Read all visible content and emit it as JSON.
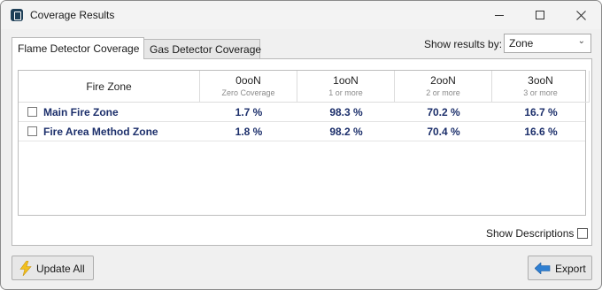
{
  "window": {
    "title": "Coverage Results"
  },
  "tabs": [
    {
      "label": "Flame Detector Coverage",
      "active": true
    },
    {
      "label": "Gas Detector Coverage",
      "active": false
    }
  ],
  "show_results": {
    "label": "Show results by:",
    "selected": "Zone"
  },
  "table": {
    "columns": [
      {
        "title": "Fire Zone",
        "subtitle": ""
      },
      {
        "title": "0ooN",
        "subtitle": "Zero Coverage"
      },
      {
        "title": "1ooN",
        "subtitle": "1 or more"
      },
      {
        "title": "2ooN",
        "subtitle": "2 or more"
      },
      {
        "title": "3ooN",
        "subtitle": "3 or more"
      }
    ],
    "rows": [
      {
        "name": "Main Fire Zone",
        "values": [
          "1.7 %",
          "98.3 %",
          "70.2 %",
          "16.7 %"
        ],
        "checked": false
      },
      {
        "name": "Fire Area Method Zone",
        "values": [
          "1.8 %",
          "98.2 %",
          "70.4 %",
          "16.6 %"
        ],
        "checked": false
      }
    ]
  },
  "show_descriptions": {
    "label": "Show Descriptions",
    "checked": false
  },
  "buttons": {
    "update_all": "Update All",
    "export": "Export"
  },
  "icons": {
    "app": "app-icon",
    "update": "lightning-bolt-icon",
    "export": "arrow-left-icon"
  },
  "colors": {
    "value_text": "#1c2f6b",
    "bolt": "#f2c01e",
    "export_arrow": "#2f7fd1"
  }
}
